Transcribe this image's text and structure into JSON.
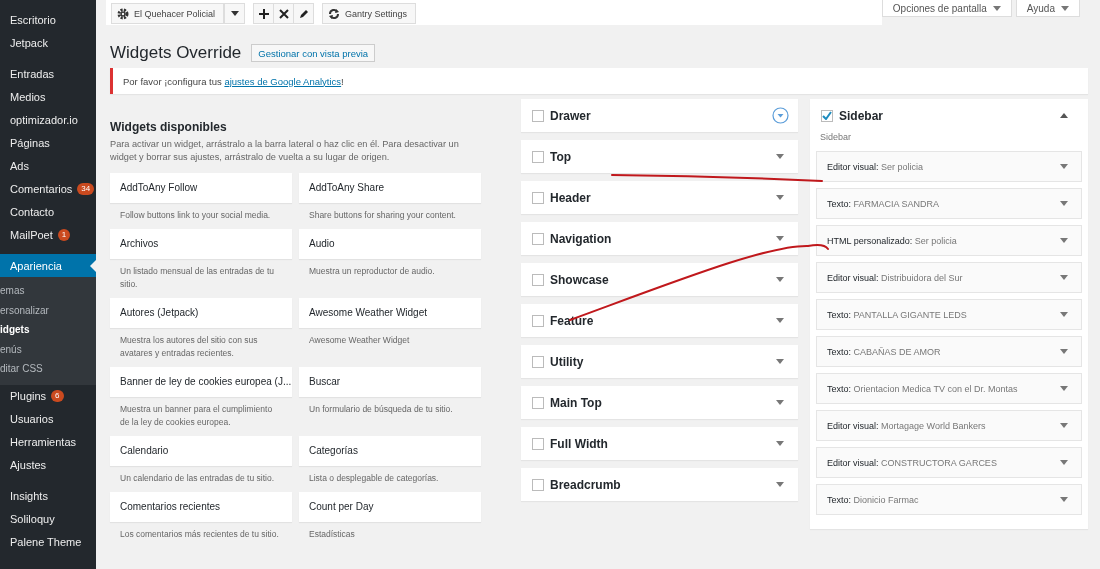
{
  "admin_menu": [
    {
      "items": [
        {
          "label": "Escritorio",
          "current": false
        },
        {
          "label": "Jetpack",
          "current": false
        }
      ]
    },
    {
      "items": [
        {
          "label": "Entradas",
          "current": false
        },
        {
          "label": "Medios",
          "current": false
        },
        {
          "label": "optimizador.io",
          "current": false
        },
        {
          "label": "Páginas",
          "current": false
        },
        {
          "label": "Ads",
          "current": false
        },
        {
          "label": "Comentarios",
          "badge": "34",
          "current": false
        },
        {
          "label": "Contacto",
          "current": false
        },
        {
          "label": "MailPoet",
          "badge": "1",
          "current": false
        }
      ]
    },
    {
      "items": [
        {
          "label": "Apariencia",
          "current": true,
          "submenu": [
            {
              "label": "emas",
              "selected": false
            },
            {
              "label": "ersonalizar",
              "selected": false
            },
            {
              "label": "idgets",
              "selected": true
            },
            {
              "label": "enús",
              "selected": false
            },
            {
              "label": "ditar CSS",
              "selected": false
            }
          ]
        },
        {
          "label": "Plugins",
          "badge": "6",
          "current": false
        },
        {
          "label": "Usuarios",
          "current": false
        },
        {
          "label": "Herramientas",
          "current": false
        },
        {
          "label": "Ajustes",
          "current": false
        }
      ]
    },
    {
      "items": [
        {
          "label": "Insights",
          "current": false
        },
        {
          "label": "Soliloquy",
          "current": false
        },
        {
          "label": "Palene Theme",
          "current": false
        }
      ]
    }
  ],
  "toolbar": {
    "override_select": "El Quehacer Policial",
    "actions": [
      {
        "kind": "add"
      },
      {
        "kind": "delete"
      },
      {
        "kind": "edit"
      }
    ],
    "settings_button": "Gantry Settings"
  },
  "screen_meta": [
    "Opciones de pantalla",
    "Ayuda"
  ],
  "page_title": "Widgets Override",
  "preview_button": "Gestionar con vista previa",
  "notice": {
    "text_before": "Por favor ¡configura tus ",
    "link": "ajustes de Google Analytics",
    "text_after": "!"
  },
  "available": {
    "title": "Widgets disponibles",
    "description": "Para activar un widget, arrástralo a la barra lateral o haz clic en él. Para desactivar un widget y borrar sus ajustes, arrástralo de vuelta a su lugar de origen.",
    "widgets": [
      {
        "name": "AddToAny Follow",
        "description": "Follow buttons link to your social media."
      },
      {
        "name": "AddToAny Share",
        "description": "Share buttons for sharing your content."
      },
      {
        "name": "Archivos",
        "description": "Un listado mensual de las entradas de tu sitio."
      },
      {
        "name": "Audio",
        "description": "Muestra un reproductor de audio."
      },
      {
        "name": "Autores (Jetpack)",
        "description": "Muestra los autores del sitio con sus avatares y entradas recientes."
      },
      {
        "name": "Awesome Weather Widget",
        "description": "Awesome Weather Widget"
      },
      {
        "name": "Banner de ley de cookies europea (J...",
        "description": "Muestra un banner para el cumplimiento de la ley de cookies europea."
      },
      {
        "name": "Buscar",
        "description": "Un formulario de búsqueda de tu sitio."
      },
      {
        "name": "Calendario",
        "description": "Un calendario de las entradas de tu sitio."
      },
      {
        "name": "Categorías",
        "description": "Lista o desplegable de categorías."
      },
      {
        "name": "Comentarios recientes",
        "description": "Los comentarios más recientes de tu sitio."
      },
      {
        "name": "Count per Day",
        "description": "Estadísticas"
      }
    ]
  },
  "areas": [
    {
      "name": "Drawer",
      "checked": false,
      "focused": true
    },
    {
      "name": "Top",
      "checked": false,
      "focused": false
    },
    {
      "name": "Header",
      "checked": false,
      "focused": false
    },
    {
      "name": "Navigation",
      "checked": false,
      "focused": false
    },
    {
      "name": "Showcase",
      "checked": false,
      "focused": false
    },
    {
      "name": "Feature",
      "checked": false,
      "focused": false
    },
    {
      "name": "Utility",
      "checked": false,
      "focused": false
    },
    {
      "name": "Main Top",
      "checked": false,
      "focused": false
    },
    {
      "name": "Full Width",
      "checked": false,
      "focused": false
    },
    {
      "name": "Breadcrumb",
      "checked": false,
      "focused": false
    }
  ],
  "sidebar_area": {
    "name": "Sidebar",
    "checked": true,
    "expanded": true,
    "description": "Sidebar",
    "widgets": [
      {
        "type": "Editor visual:",
        "title": "Ser policia"
      },
      {
        "type": "Texto:",
        "title": "FARMACIA SANDRA"
      },
      {
        "type": "HTML personalizado:",
        "title": "Ser policia"
      },
      {
        "type": "Editor visual:",
        "title": "Distribuidora del Sur"
      },
      {
        "type": "Texto:",
        "title": "PANTALLA GIGANTE LEDS"
      },
      {
        "type": "Texto:",
        "title": "CABAÑAS DE AMOR"
      },
      {
        "type": "Texto:",
        "title": "Orientacion Medica TV con el Dr. Montas"
      },
      {
        "type": "Editor visual:",
        "title": "Mortagage World Bankers"
      },
      {
        "type": "Editor visual:",
        "title": "CONSTRUCTORA GARCES"
      },
      {
        "type": "Texto:",
        "title": "Dionicio Farmac"
      }
    ]
  },
  "annotations": [
    {
      "kind": "straight-stroke"
    },
    {
      "kind": "rising-stroke"
    }
  ]
}
